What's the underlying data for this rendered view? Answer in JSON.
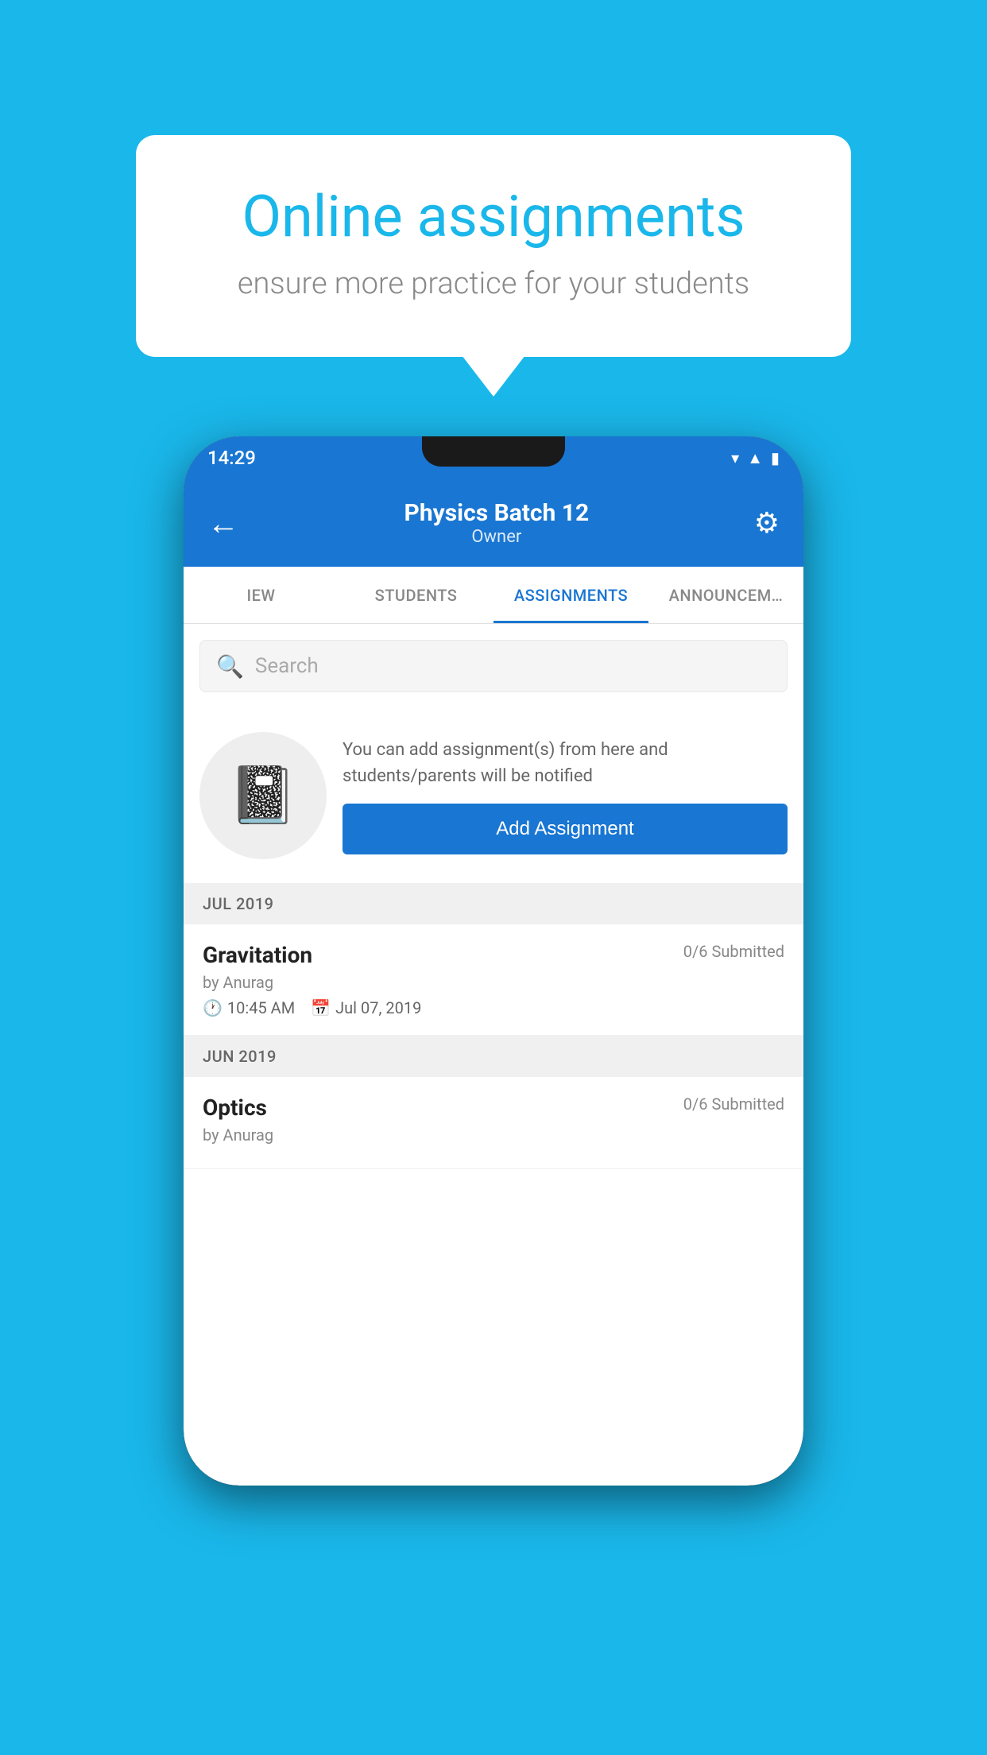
{
  "background_color": "#1ab7ea",
  "speech_bubble": {
    "title": "Online assignments",
    "subtitle": "ensure more practice for your students"
  },
  "status_bar": {
    "time": "14:29",
    "icons": [
      "wifi",
      "signal",
      "battery"
    ]
  },
  "header": {
    "title": "Physics Batch 12",
    "subtitle": "Owner",
    "back_label": "←",
    "settings_label": "⚙"
  },
  "tabs": [
    {
      "label": "IEW",
      "active": false
    },
    {
      "label": "STUDENTS",
      "active": false
    },
    {
      "label": "ASSIGNMENTS",
      "active": true
    },
    {
      "label": "ANNOUNCEM…",
      "active": false
    }
  ],
  "search": {
    "placeholder": "Search"
  },
  "empty_state": {
    "description": "You can add assignment(s) from here and students/parents will be notified",
    "button_label": "Add Assignment"
  },
  "sections": [
    {
      "header": "JUL 2019",
      "items": [
        {
          "name": "Gravitation",
          "submitted": "0/6 Submitted",
          "by": "by Anurag",
          "time": "10:45 AM",
          "date": "Jul 07, 2019"
        }
      ]
    },
    {
      "header": "JUN 2019",
      "items": [
        {
          "name": "Optics",
          "submitted": "0/6 Submitted",
          "by": "by Anurag",
          "time": "",
          "date": ""
        }
      ]
    }
  ]
}
